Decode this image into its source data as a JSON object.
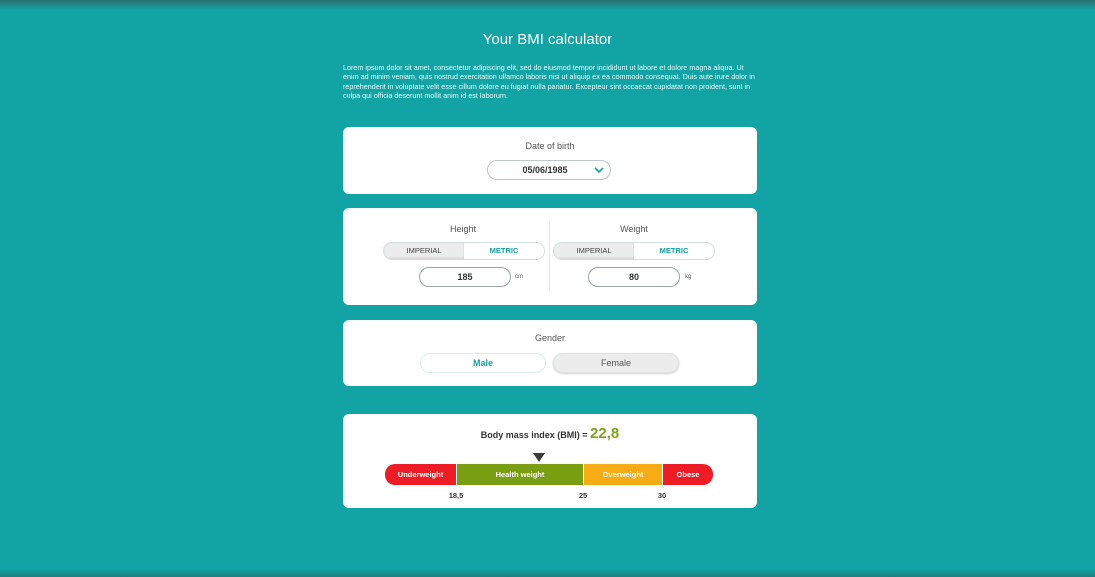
{
  "page": {
    "title": "Your BMI calculator",
    "intro": "Lorem ipsum dolor sit amet, consectetur adipiscing elit, sed do eiusmod tempor incididunt ut labore et dolore magna aliqua. Ut enim ad minim veniam, quis nostrud exercitation ullamco laboris nisi ut aliquip ex ea commodo consequat. Duis aute irure dolor in reprehenderit in voluptate velit esse cillum dolore eu fugiat nulla pariatur. Excepteur sint occaecat cupidatat non proident, sunt in culpa qui officia deserunt mollit anim id est laborum."
  },
  "dob": {
    "label": "Date of birth",
    "value": "05/06/1985",
    "icon": "chevron-down-icon"
  },
  "height": {
    "label": "Height",
    "imperial_label": "IMPERIAL",
    "metric_label": "METRIC",
    "selected_unit": "METRIC",
    "value": "185",
    "unit": "cm"
  },
  "weight": {
    "label": "Weight",
    "imperial_label": "IMPERIAL",
    "metric_label": "METRIC",
    "selected_unit": "METRIC",
    "value": "80",
    "unit": "kg"
  },
  "gender": {
    "label": "Gender",
    "male_label": "Male",
    "female_label": "Female",
    "selected": "Male"
  },
  "bmi": {
    "label": "Body mass index (BMI) =",
    "value": "22,8",
    "value_numeric": 22.8,
    "categories": [
      {
        "label": "Underweight",
        "color": "#ee1c25"
      },
      {
        "label": "Health weight",
        "color": "#7a9e12"
      },
      {
        "label": "Overweight",
        "color": "#f7ab14"
      },
      {
        "label": "Obese",
        "color": "#ee1c25"
      }
    ],
    "ticks": [
      "18,5",
      "25",
      "30"
    ]
  },
  "colors": {
    "background": "#12a3a4",
    "accent": "#12a3a4",
    "bmi_value": "#7aa51a"
  }
}
